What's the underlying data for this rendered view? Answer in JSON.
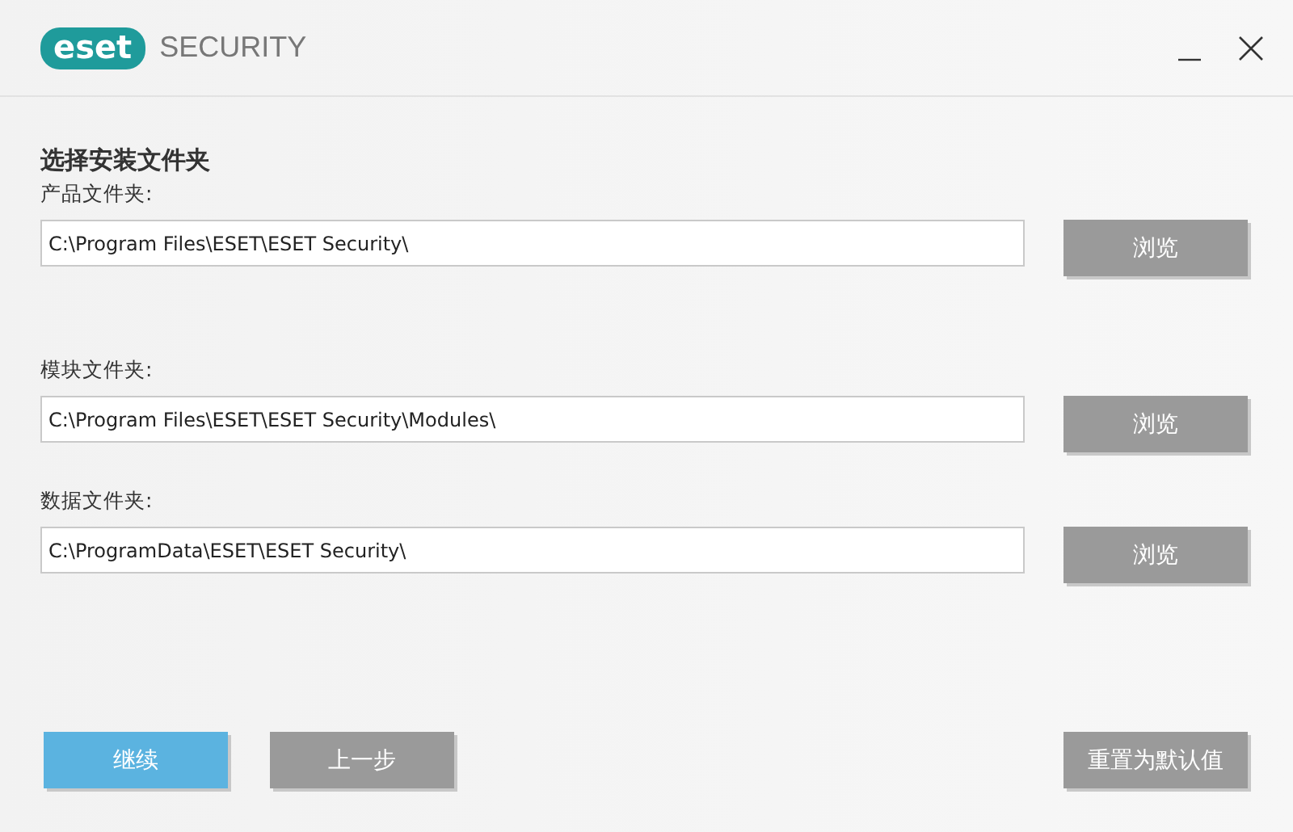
{
  "header": {
    "logo": "eset",
    "product": "SECURITY"
  },
  "section_title": "选择安装文件夹",
  "folders": [
    {
      "label": "产品文件夹:",
      "value": "C:\\Program Files\\ESET\\ESET Security\\",
      "button": "浏览"
    },
    {
      "label": "模块文件夹:",
      "value": "C:\\Program Files\\ESET\\ESET Security\\Modules\\",
      "button": "浏览"
    },
    {
      "label": "数据文件夹:",
      "value": "C:\\ProgramData\\ESET\\ESET Security\\",
      "button": "浏览"
    }
  ],
  "footer": {
    "buttons": [
      {
        "label": "继续",
        "kind": "primary"
      },
      {
        "label": "上一步",
        "kind": "secondary"
      }
    ],
    "reset": "重置为默认值"
  }
}
